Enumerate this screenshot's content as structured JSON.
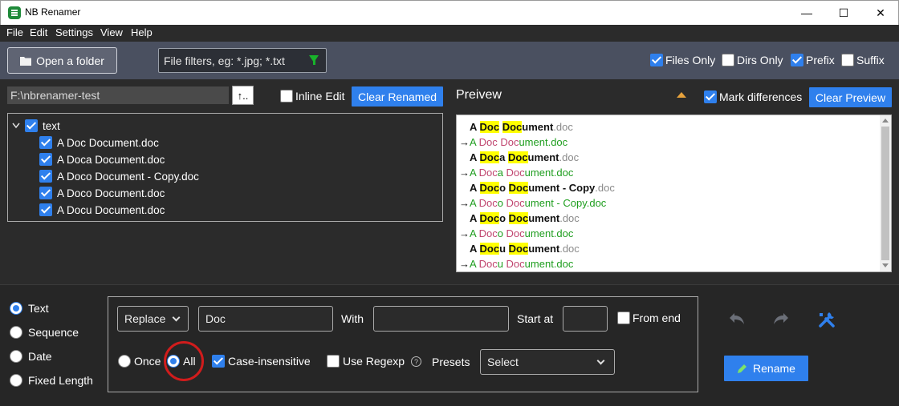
{
  "window": {
    "title": "NB Renamer",
    "minimize": "—",
    "maximize": "☐",
    "close": "✕"
  },
  "menu": [
    "File",
    "Edit",
    "Settings",
    "View",
    "Help"
  ],
  "toolbar": {
    "open_folder": "Open a folder",
    "filter_placeholder": "File filters, eg: *.jpg; *.txt",
    "files_only": "Files Only",
    "dirs_only": "Dirs Only",
    "prefix": "Prefix",
    "suffix": "Suffix",
    "files_only_checked": true,
    "dirs_only_checked": false,
    "prefix_checked": true,
    "suffix_checked": false
  },
  "left": {
    "path": "F:\\nbrenamer-test",
    "up_button": "↑..",
    "inline_edit": "Inline Edit",
    "clear_renamed": "Clear Renamed",
    "root": "text",
    "files": [
      "A Doc Document.doc",
      "A Doca Document.doc",
      "A Doco Document - Copy.doc",
      "A Doco Document.doc",
      "A Docu Document.doc"
    ]
  },
  "preview": {
    "title": "Preivew",
    "mark_differences": "Mark differences",
    "clear_preview": "Clear Preview"
  },
  "mode": {
    "text": "Text",
    "sequence": "Sequence",
    "date": "Date",
    "fixed_length": "Fixed Length",
    "selected": "Text"
  },
  "options": {
    "operation": "Replace",
    "find": "Doc",
    "with_label": "With",
    "with_value": "",
    "start_at_label": "Start at",
    "start_at_value": "",
    "from_end": "From end",
    "once": "Once",
    "all": "All",
    "case_insensitive": "Case-insensitive",
    "use_regexp": "Use Regexp",
    "help": "?",
    "presets_label": "Presets",
    "presets_value": "Select"
  },
  "actions": {
    "rename": "Rename"
  },
  "colors": {
    "accent": "#2f80ed",
    "highlight": "#ffff00",
    "added": "#1f9e1f",
    "removed": "#c0456f",
    "ring": "#d01c1c"
  }
}
